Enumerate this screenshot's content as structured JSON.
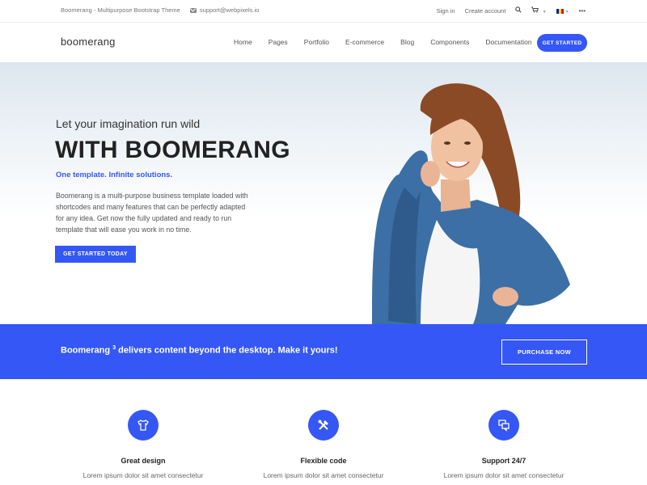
{
  "topbar": {
    "theme_name": "Boomerang - Multipurpose Bootstrap Theme",
    "email": "support@webpixels.io",
    "sign_in": "Sign in",
    "create_account": "Create account",
    "more": "•••"
  },
  "navbar": {
    "logo": "boomerang",
    "items": [
      "Home",
      "Pages",
      "Portfolio",
      "E-commerce",
      "Blog",
      "Components",
      "Documentation"
    ],
    "cta": "GET STARTED"
  },
  "hero": {
    "subtitle": "Let your imagination run wild",
    "title": "WITH BOOMERANG",
    "tagline": "One template. Infinite solutions.",
    "description": "Boomerang is a multi-purpose business template loaded with shortcodes and many features that can be perfectly adapted for any idea. Get now the fully updated and ready to run template that will ease you work in no time.",
    "button": "GET STARTED TODAY"
  },
  "banner": {
    "text_before": "Boomerang ",
    "superscript": "3",
    "text_after": " delivers content beyond the desktop. Make it yours!",
    "button": "PURCHASE NOW"
  },
  "features": [
    {
      "title": "Great design",
      "text": "Lorem ipsum dolor sit amet consectetur",
      "icon": "tshirt-icon"
    },
    {
      "title": "Flexible code",
      "text": "Lorem ipsum dolor sit amet consectetur",
      "icon": "tools-icon"
    },
    {
      "title": "Support 24/7",
      "text": "Lorem ipsum dolor sit amet consectetur",
      "icon": "chat-icon"
    }
  ],
  "colors": {
    "accent": "#3557f5",
    "text_dark": "#222222",
    "text_muted": "#666666"
  }
}
